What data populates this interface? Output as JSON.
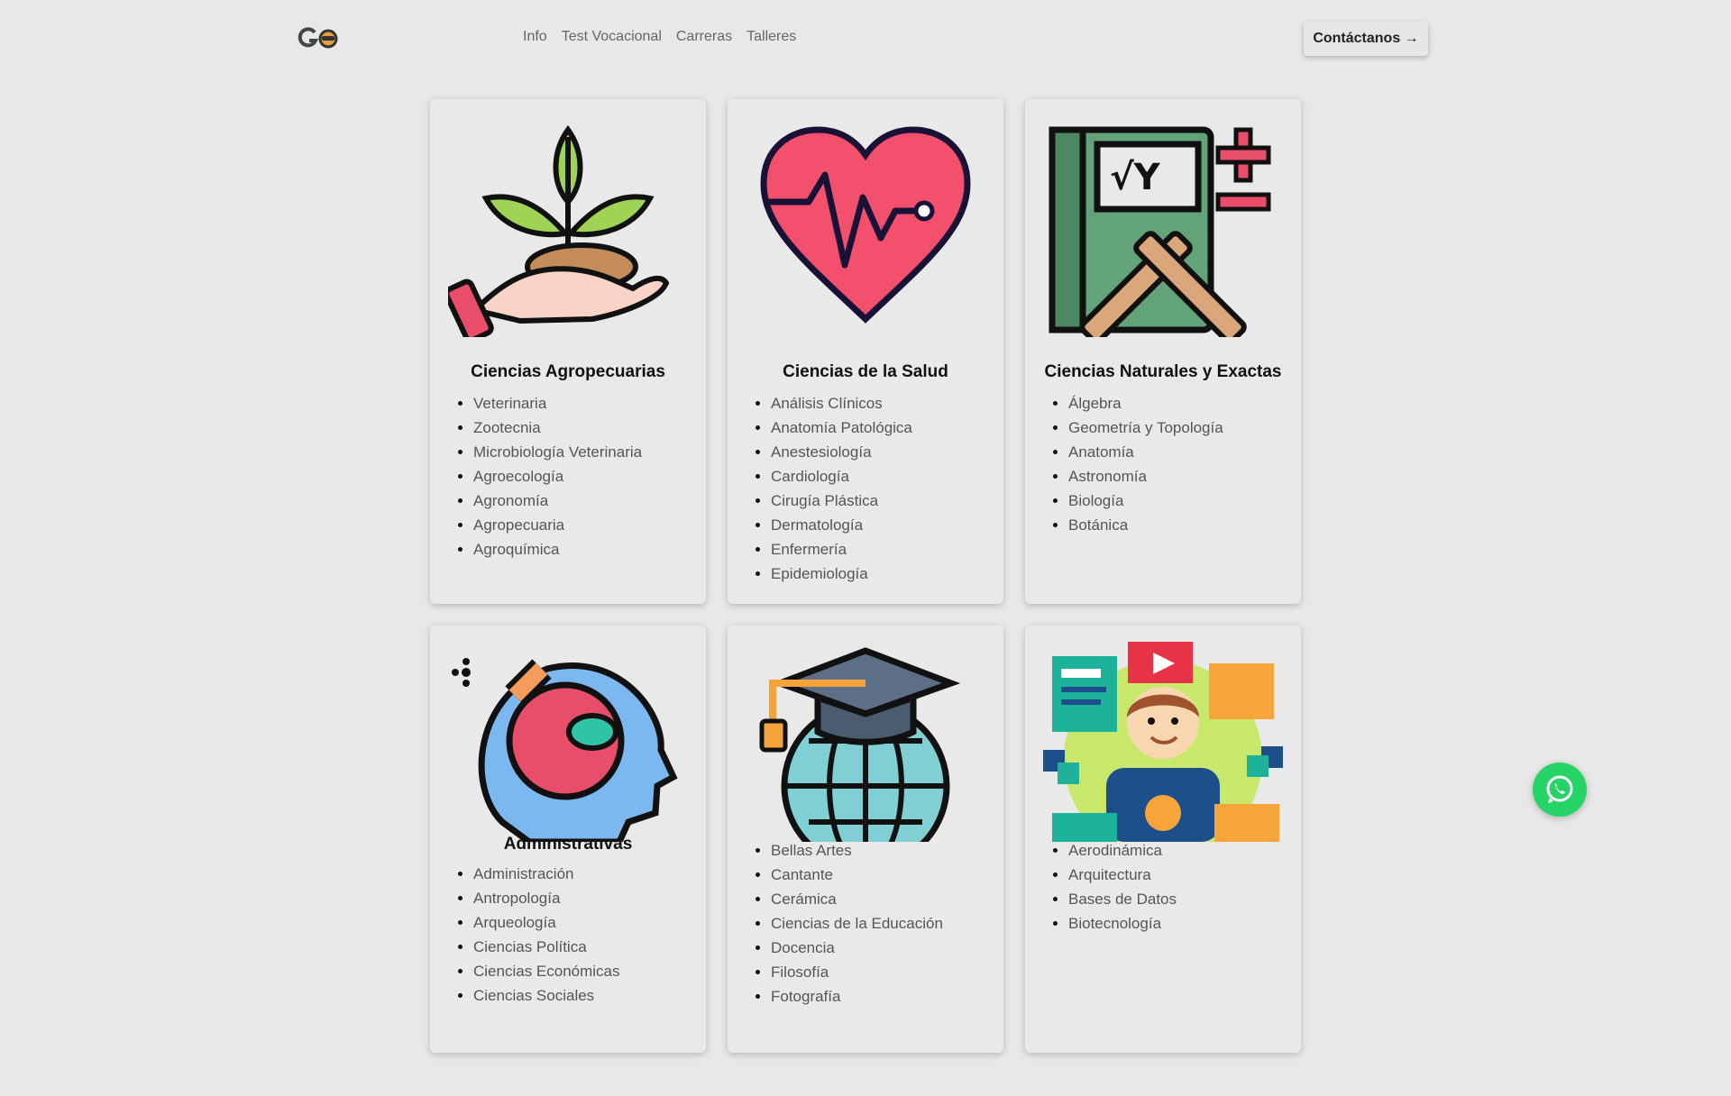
{
  "nav": {
    "logo_text": "GO",
    "links": [
      "Info",
      "Test Vocacional",
      "Carreras",
      "Talleres"
    ],
    "contact_label": "Contáctanos →"
  },
  "cards": [
    {
      "title": "Ciencias Agropecuarias",
      "icon": "plant-in-hand-icon",
      "items": [
        "Veterinaria",
        "Zootecnia",
        "Microbiología Veterinaria",
        "Agroecología",
        "Agronomía",
        "Agropecuaria",
        "Agroquímica"
      ]
    },
    {
      "title": "Ciencias de la Salud",
      "icon": "heartbeat-icon",
      "items": [
        "Análisis Clínicos",
        "Anatomía Patológica",
        "Anestesiología",
        "Cardiología",
        "Cirugía Plástica",
        "Dermatología",
        "Enfermería",
        "Epidemiología"
      ]
    },
    {
      "title": "Ciencias Naturales y Exactas",
      "icon": "math-book-icon",
      "items": [
        "Álgebra",
        "Geometría y Topología",
        "Anatomía",
        "Astronomía",
        "Biología",
        "Botánica"
      ]
    },
    {
      "title": "Administrativas",
      "icon": "science-head-icon",
      "items": [
        "Administración",
        "Antropología",
        "Arqueología",
        "Ciencias Política",
        "Ciencias Económicas",
        "Ciencias Sociales"
      ]
    },
    {
      "title": "",
      "icon": "graduation-globe-icon",
      "items": [
        "Bellas Artes",
        "Cantante",
        "Cerámica",
        "Ciencias de la Educación",
        "Docencia",
        "Filosofía",
        "Fotografía"
      ]
    },
    {
      "title": "",
      "icon": "tech-person-icon",
      "items": [
        "Aerodinámica",
        "Arquitectura",
        "Bases de Datos",
        "Biotecnología"
      ]
    }
  ],
  "whatsapp": {
    "icon": "whatsapp-icon"
  },
  "colors": {
    "background": "#e8e8e8",
    "card": "#e9e9e9",
    "whatsapp": "#25d366"
  }
}
